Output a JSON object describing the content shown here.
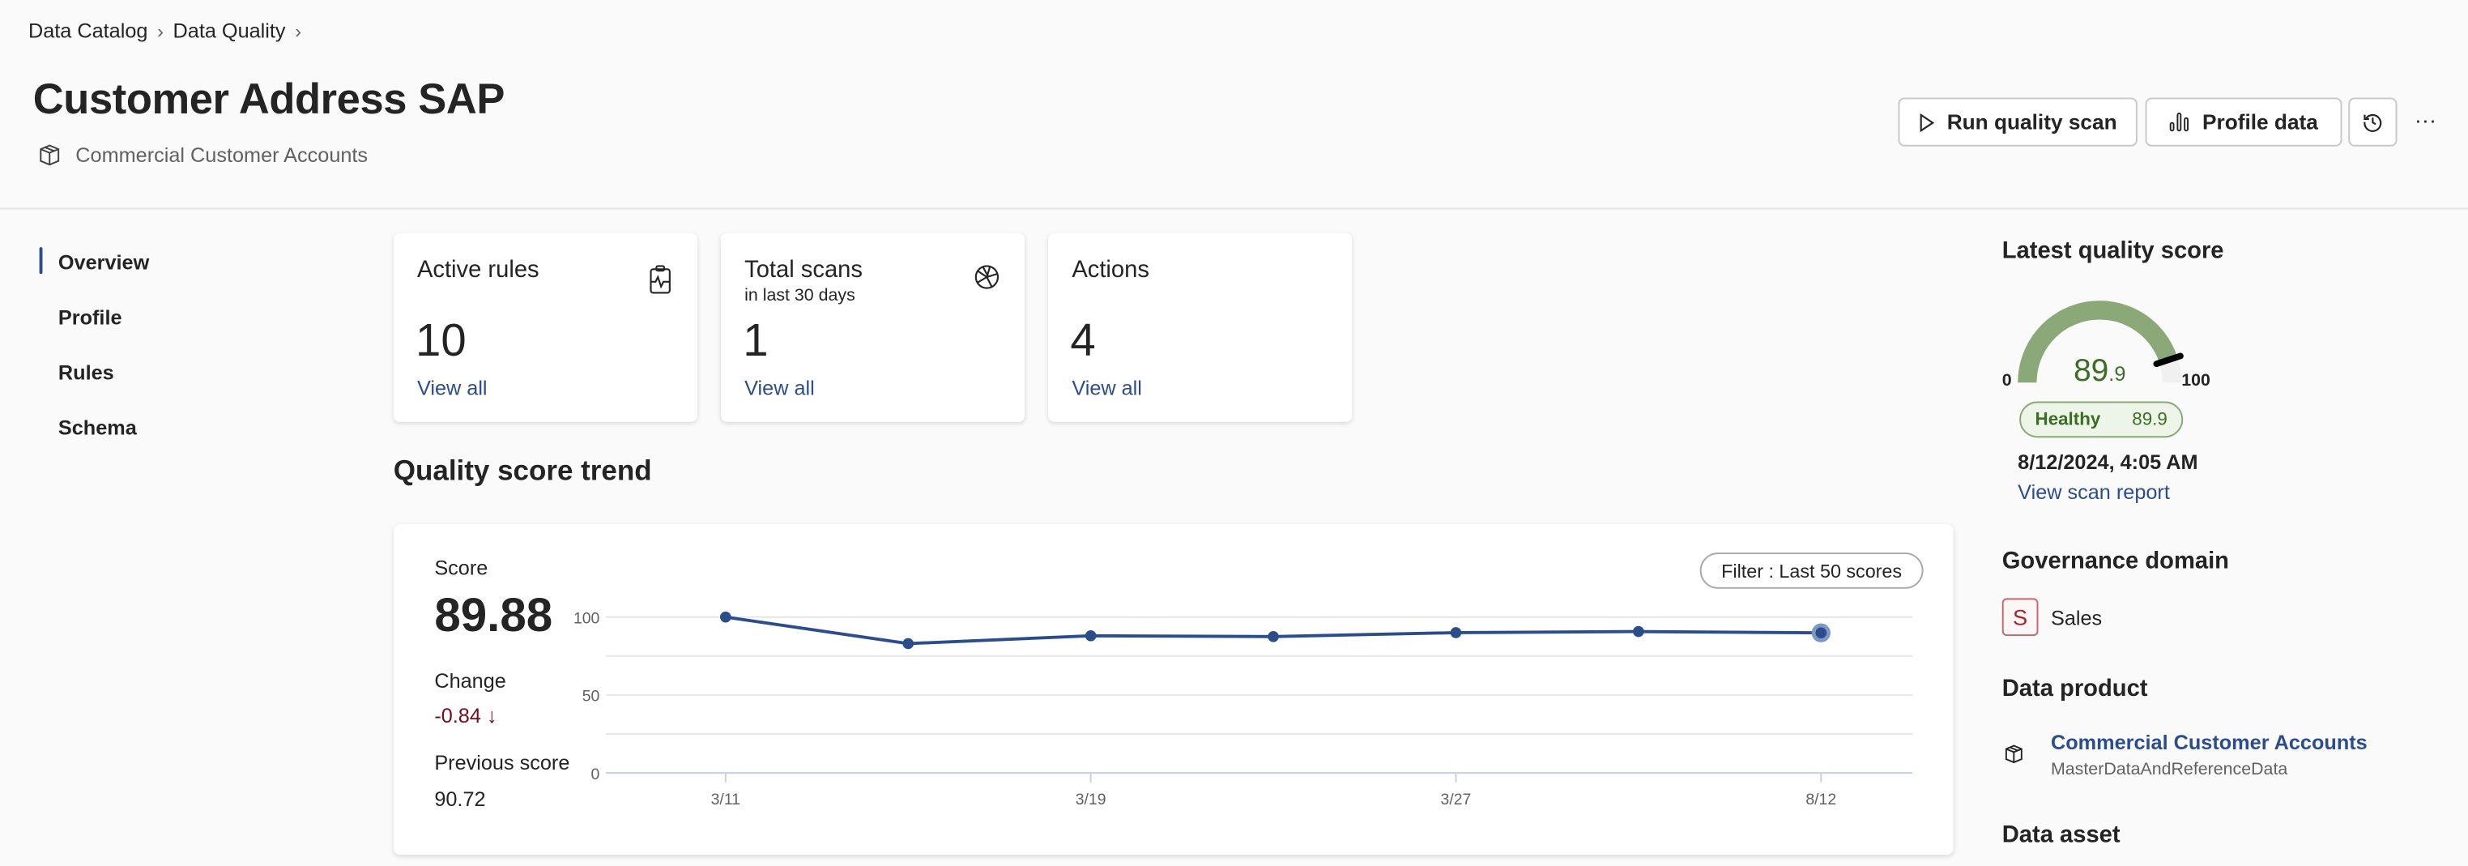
{
  "breadcrumb": [
    {
      "label": "Data Catalog"
    },
    {
      "label": "Data Quality"
    }
  ],
  "header": {
    "title": "Customer Address SAP",
    "subtitle": "Commercial Customer Accounts",
    "subtitle_icon": "cube-icon"
  },
  "toolbar": {
    "run_scan": "Run quality scan",
    "profile": "Profile data",
    "history_icon": "history-icon",
    "more": "···"
  },
  "nav": {
    "active": "Overview",
    "items": [
      {
        "label": "Overview"
      },
      {
        "label": "Profile"
      },
      {
        "label": "Rules"
      },
      {
        "label": "Schema"
      }
    ]
  },
  "cards": [
    {
      "title": "Active rules",
      "subtitle": "",
      "value": "10",
      "link": "View all",
      "icon": "clipboard-pulse-icon"
    },
    {
      "title": "Total scans",
      "subtitle": "in last 30 days",
      "value": "1",
      "link": "View all",
      "icon": "aperture-icon"
    },
    {
      "title": "Actions",
      "subtitle": "",
      "value": "4",
      "link": "View all",
      "icon": ""
    }
  ],
  "trend": {
    "title": "Quality score trend",
    "score_label": "Score",
    "score": "89.88",
    "change_label": "Change",
    "change": "-0.84 ↓",
    "previous_label": "Previous score",
    "previous": "90.72",
    "filter": "Filter : Last 50 scores"
  },
  "chart_data": {
    "type": "line",
    "categories": [
      "3/11",
      "",
      "3/19",
      "",
      "3/27",
      "",
      "8/12"
    ],
    "x_tick_labels": [
      "3/11",
      "3/19",
      "3/27",
      "8/12"
    ],
    "values": [
      100,
      83,
      88,
      87.5,
      90,
      90.72,
      89.88
    ],
    "ylim": [
      0,
      100
    ],
    "y_ticks": [
      0,
      50,
      100
    ],
    "grid": true,
    "color": "#2b4d8c"
  },
  "latest": {
    "title": "Latest quality score",
    "value": 89.9,
    "value_int": "89",
    "value_dec": ".9",
    "min": "0",
    "max": "100",
    "status": "Healthy",
    "status_value": "89.9",
    "timestamp": "8/12/2024, 4:05 AM",
    "report_link": "View scan report",
    "gauge_color": "#8aa878",
    "text_color": "#3b6e22"
  },
  "governance": {
    "title": "Governance domain",
    "badge": "S",
    "name": "Sales",
    "badge_color": "#a4262c"
  },
  "product": {
    "title": "Data product",
    "name": "Commercial Customer Accounts",
    "sub": "MasterDataAndReferenceData"
  },
  "asset": {
    "title": "Data asset"
  }
}
